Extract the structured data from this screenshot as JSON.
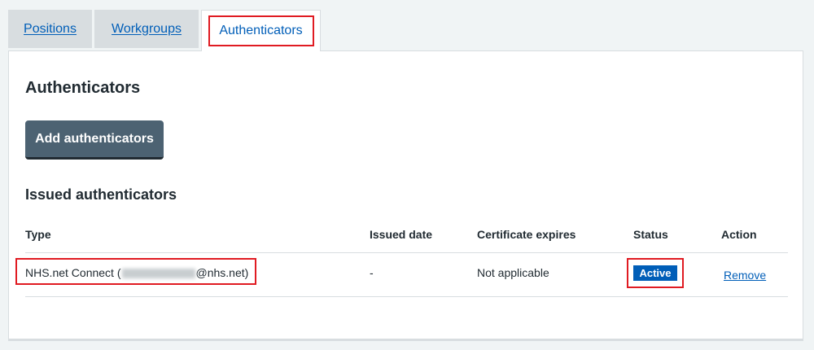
{
  "tabs": [
    {
      "label": "Positions",
      "active": false
    },
    {
      "label": "Workgroups",
      "active": false
    },
    {
      "label": "Authenticators",
      "active": true
    }
  ],
  "page": {
    "title": "Authenticators",
    "add_button_label": "Add authenticators",
    "section_title": "Issued authenticators"
  },
  "table": {
    "headers": {
      "type": "Type",
      "issued_date": "Issued date",
      "certificate_expires": "Certificate expires",
      "status": "Status",
      "action": "Action"
    },
    "rows": [
      {
        "type_prefix": "NHS.net Connect (",
        "type_suffix": "@nhs.net)",
        "issued_date": "-",
        "certificate_expires": "Not applicable",
        "status": "Active",
        "action": "Remove"
      }
    ]
  },
  "colors": {
    "link": "#005eb8",
    "highlight": "#e01b22",
    "button": "#4c6272",
    "badge": "#005eb8",
    "background": "#f0f4f5"
  }
}
